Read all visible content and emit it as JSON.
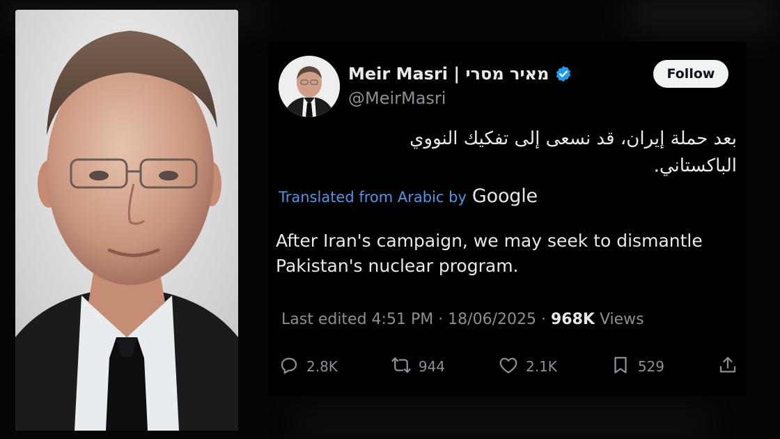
{
  "tweet": {
    "display_name": "Meir Masri | מאיר מסרי",
    "handle": "@MeirMasri",
    "follow_label": "Follow",
    "arabic_text": "بعد حملة إيران، قد نسعى إلى تفكيك النووي الباكستاني.",
    "translated_prefix": "Translated from Arabic by",
    "translated_brand": "Google",
    "translation": "After Iran's campaign, we may seek to dismantle Pakistan's nuclear program.",
    "edited_text": "Last edited 4:51 PM · 18/06/2025 · ",
    "views_count": "968K",
    "views_label": " Views"
  },
  "actions": {
    "replies": "2.8K",
    "reposts": "944",
    "likes": "2.1K",
    "bookmarks": "529"
  },
  "icons": [
    "verified-badge-icon",
    "reply-icon",
    "repost-icon",
    "like-icon",
    "bookmark-icon",
    "share-icon"
  ],
  "colors": {
    "background": "#000000",
    "text": "#e7e9ea",
    "muted": "#8b9096",
    "link_blue": "#4a99e9",
    "verified_blue": "#1d9bf0"
  }
}
